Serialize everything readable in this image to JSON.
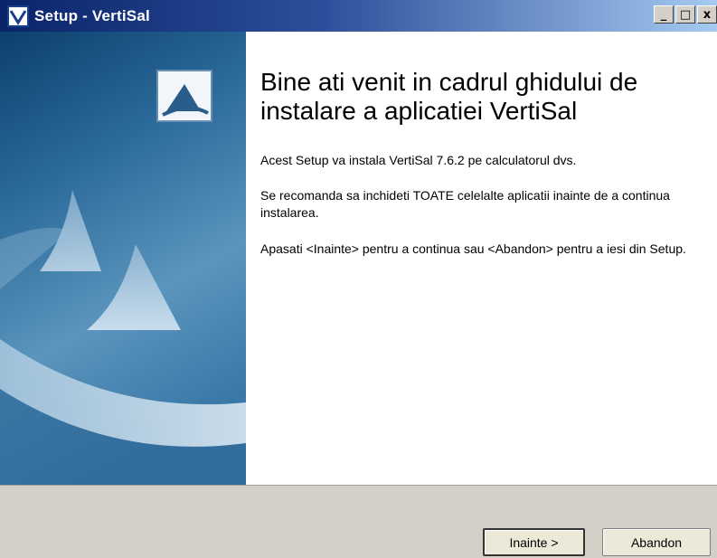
{
  "window": {
    "title": "Setup - VertiSal",
    "minimize": "_",
    "maximize": "□",
    "close": "x"
  },
  "welcome": {
    "title": "Bine ati venit in cadrul ghidului de instalare a aplicatiei VertiSal",
    "line1": "Acest Setup va instala VertiSal 7.6.2 pe calculatorul dvs.",
    "line2": "Se recomanda sa inchideti TOATE celelalte aplicatii inainte de a continua instalarea.",
    "line3": "Apasati <Inainte> pentru a continua sau <Abandon> pentru a iesi din Setup."
  },
  "buttons": {
    "next": "Inainte >",
    "cancel": "Abandon"
  },
  "colors": {
    "titlebar_start": "#0a246a",
    "banner_blue": "#1f5a8c",
    "panel": "#ffffff"
  }
}
